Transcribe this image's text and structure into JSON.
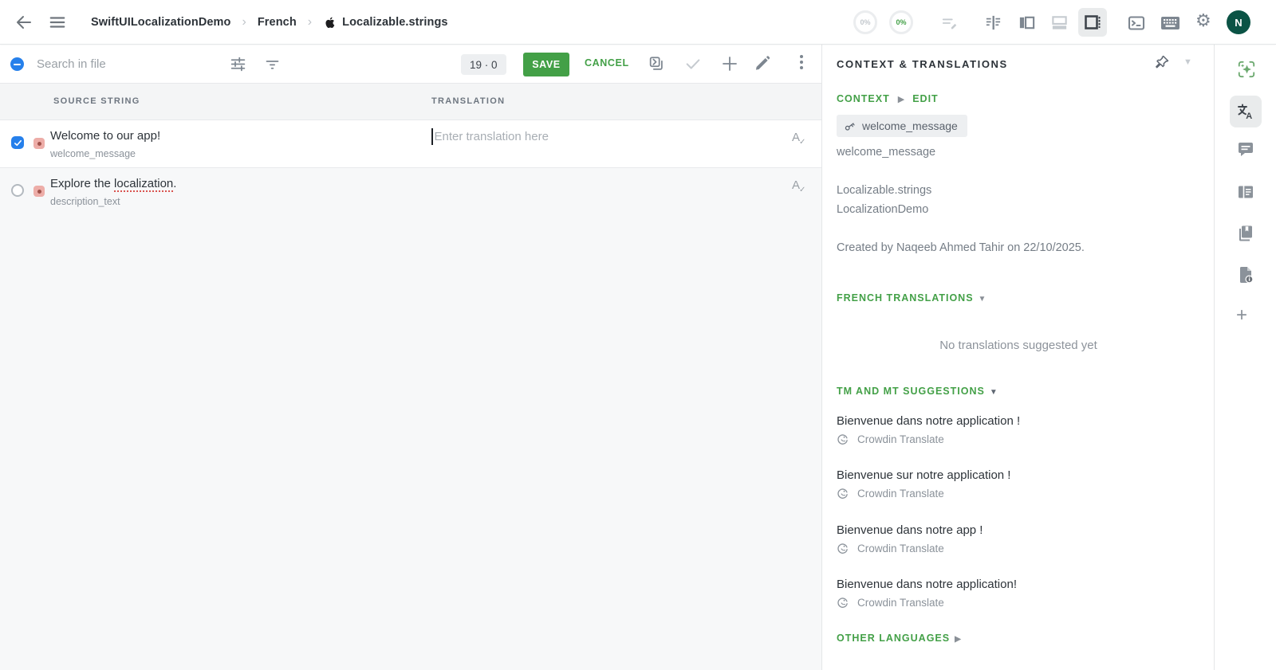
{
  "topbar": {
    "breadcrumb": {
      "project": "SwiftUILocalizationDemo",
      "separator": "›",
      "language": "French",
      "file": "Localizable.strings"
    },
    "progress_file": "0%",
    "progress_approved": "0%",
    "avatar_initial": "N"
  },
  "toolbar": {
    "search_placeholder": "Search in file",
    "counter": "19 · 0",
    "save_label": "SAVE",
    "cancel_label": "CANCEL"
  },
  "table": {
    "source_header": "SOURCE STRING",
    "translation_header": "TRANSLATION",
    "rows": [
      {
        "source": "Welcome to our app!",
        "key": "welcome_message",
        "translation_placeholder": "Enter translation here"
      },
      {
        "source_prefix": "Explore the ",
        "source_misspelled": "localization",
        "source_suffix": ".",
        "key": "description_text"
      }
    ]
  },
  "panel": {
    "title": "CONTEXT & TRANSLATIONS",
    "context_label": "CONTEXT",
    "edit_label": "EDIT",
    "key_chip": "welcome_message",
    "key_name": "welcome_message",
    "file_name": "Localizable.strings",
    "project_name": "LocalizationDemo",
    "created_note": "Created by Naqeeb Ahmed Tahir on 22/10/2025.",
    "translations_section": "FRENCH TRANSLATIONS",
    "empty_translations": "No translations suggested yet",
    "suggestions_section": "TM AND MT SUGGESTIONS",
    "suggestions": [
      {
        "text": "Bienvenue dans notre application !",
        "provider": "Crowdin Translate"
      },
      {
        "text": "Bienvenue sur notre application !",
        "provider": "Crowdin Translate"
      },
      {
        "text": "Bienvenue dans notre app !",
        "provider": "Crowdin Translate"
      },
      {
        "text": "Bienvenue dans notre application!",
        "provider": "Crowdin Translate"
      }
    ],
    "other_languages_section": "OTHER LANGUAGES"
  },
  "colors": {
    "accent_green": "#43a047",
    "ai_green": "#6ca96f",
    "checkbox_blue": "#2680eb",
    "avatar_green": "#0b5345",
    "badge_pink": "#edada8",
    "badge_dot": "#a0524b",
    "icon_gray": "#7d8690",
    "text_primary": "#2d3339",
    "text_secondary": "#8b929a",
    "panel_border": "#e4e6e8",
    "main_bg": "#f7f8f9"
  },
  "icons": [
    "back-arrow-icon",
    "menu-icon",
    "apple-icon",
    "notes-edit-icon",
    "split-view-icon",
    "left-panel-icon",
    "bottom-panel-icon",
    "right-panel-icon",
    "terminal-icon",
    "keyboard-icon",
    "gear-icon",
    "tune-icon",
    "filter-icon",
    "copy-source-icon",
    "check-icon",
    "plus-icon",
    "pencil-icon",
    "kebab-icon",
    "spellcheck-icon",
    "pin-icon",
    "key-icon",
    "ai-sparkle-icon",
    "translate-icon",
    "comment-icon",
    "article-icon",
    "glossary-icon",
    "file-info-icon",
    "crowdin-icon"
  ]
}
